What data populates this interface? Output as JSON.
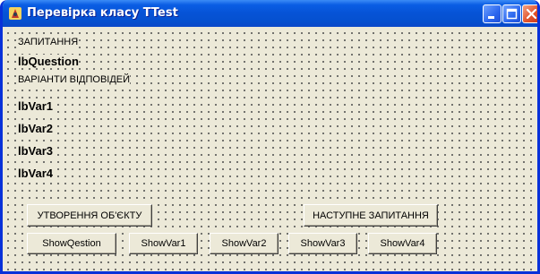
{
  "window": {
    "title": "Перевірка класу TTest"
  },
  "labels": {
    "question_caption": "ЗАПИТАННЯ",
    "question_value": "lbQuestion",
    "answers_caption": "ВАРІАНТИ ВІДПОВІДЕЙ",
    "var1": "lbVar1",
    "var2": "lbVar2",
    "var3": "lbVar3",
    "var4": "lbVar4"
  },
  "buttons": {
    "create_object": "УТВОРЕННЯ ОБ'ЄКТУ",
    "next_question": "НАСТУПНЕ ЗАПИТАННЯ",
    "show_question": "ShowQestion",
    "show_var1": "ShowVar1",
    "show_var2": "ShowVar2",
    "show_var3": "ShowVar3",
    "show_var4": "ShowVar4"
  },
  "icons": {
    "app": "delphi-app-icon",
    "minimize": "minimize-icon",
    "maximize": "maximize-icon",
    "close": "close-icon"
  },
  "colors": {
    "titlebar": "#0653D6",
    "form_background": "#ECE9D8",
    "close_button": "#E2542C"
  }
}
